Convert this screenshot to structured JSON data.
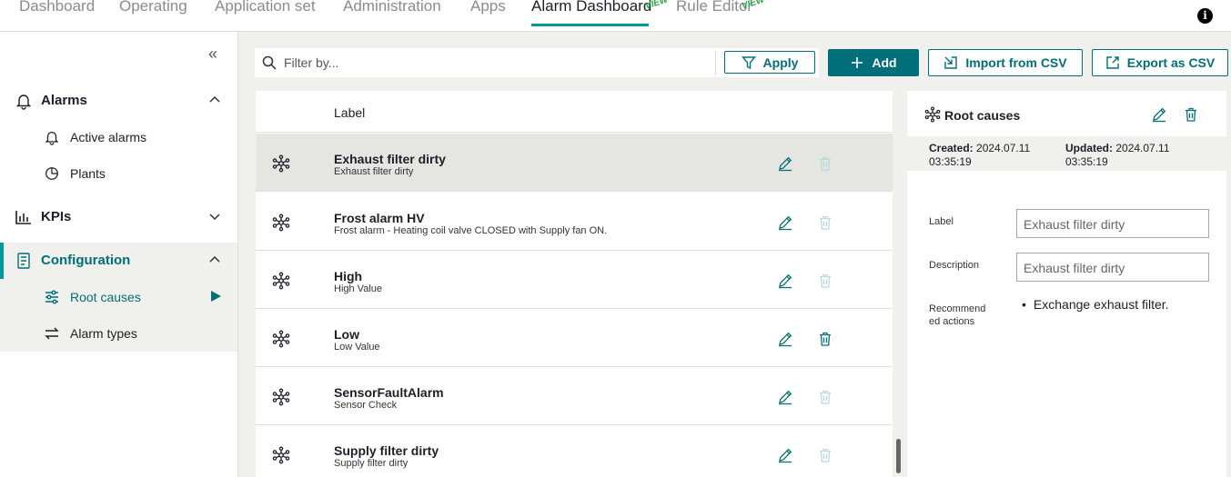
{
  "nav": {
    "tabs": [
      "Dashboard",
      "Operating",
      "Application set",
      "Administration",
      "Apps",
      "Alarm Dashboard",
      "Rule Editor"
    ],
    "preview_badge": "VIEW",
    "info_glyph": "i"
  },
  "sidebar": {
    "collapse_glyph": "«",
    "alarms_label": "Alarms",
    "active_alarms_label": "Active alarms",
    "plants_label": "Plants",
    "kpis_label": "KPIs",
    "configuration_label": "Configuration",
    "root_causes_label": "Root causes",
    "alarm_types_label": "Alarm types"
  },
  "toolbar": {
    "filter_placeholder": "Filter by...",
    "apply_label": "Apply",
    "add_label": "Add",
    "import_label": "Import from CSV",
    "export_label": "Export as CSV"
  },
  "list": {
    "header_label": "Label",
    "rows": [
      {
        "title": "Exhaust filter dirty",
        "subtitle": "Exhaust filter dirty"
      },
      {
        "title": "Frost alarm HV",
        "subtitle": "Frost alarm - Heating coil valve CLOSED with Supply fan ON."
      },
      {
        "title": "High",
        "subtitle": "High Value"
      },
      {
        "title": "Low",
        "subtitle": "Low Value"
      },
      {
        "title": "SensorFaultAlarm",
        "subtitle": "Sensor Check"
      },
      {
        "title": "Supply filter dirty",
        "subtitle": "Supply filter dirty"
      }
    ]
  },
  "detail": {
    "title": "Root causes",
    "created_label": "Created:",
    "created_date": "2024.07.11",
    "created_time": "03:35:19",
    "updated_label": "Updated:",
    "updated_date": "2024.07.11",
    "updated_time": "03:35:19",
    "label_field_label": "Label",
    "label_field_value": "Exhaust filter dirty",
    "description_field_label": "Description",
    "description_field_value": "Exhaust filter dirty",
    "recommended_label_line1": "Recommend",
    "recommended_label_line2": "ed actions",
    "recommended_actions": [
      "Exchange exhaust filter."
    ]
  },
  "colors": {
    "accent": "#006f7a",
    "active_tab_underline": "#009999",
    "preview_badge": "#28a745"
  }
}
